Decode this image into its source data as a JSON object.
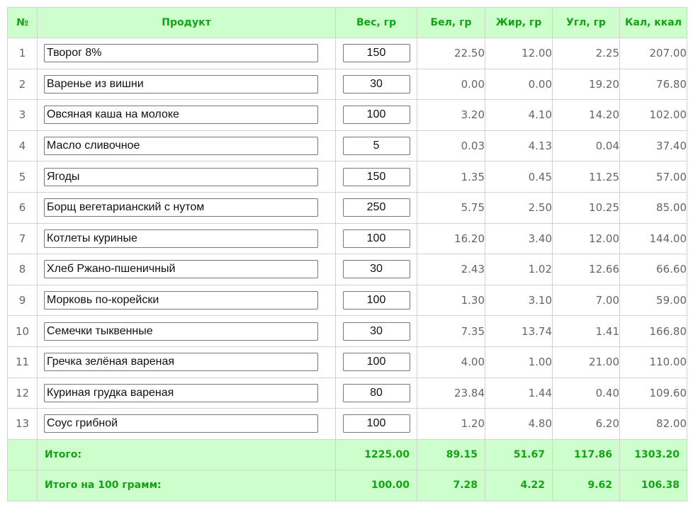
{
  "headers": {
    "num": "№",
    "product": "Продукт",
    "weight": "Вес, гр",
    "protein": "Бел, гр",
    "fat": "Жир, гр",
    "carbs": "Угл, гр",
    "kcal": "Кал, ккал"
  },
  "rows": [
    {
      "num": "1",
      "product": "Творог 8%",
      "weight": "150",
      "protein": "22.50",
      "fat": "12.00",
      "carbs": "2.25",
      "kcal": "207.00"
    },
    {
      "num": "2",
      "product": "Варенье из вишни",
      "weight": "30",
      "protein": "0.00",
      "fat": "0.00",
      "carbs": "19.20",
      "kcal": "76.80"
    },
    {
      "num": "3",
      "product": "Овсяная каша на молоке",
      "weight": "100",
      "protein": "3.20",
      "fat": "4.10",
      "carbs": "14.20",
      "kcal": "102.00"
    },
    {
      "num": "4",
      "product": "Масло сливочное",
      "weight": "5",
      "protein": "0.03",
      "fat": "4.13",
      "carbs": "0.04",
      "kcal": "37.40"
    },
    {
      "num": "5",
      "product": "Ягоды",
      "weight": "150",
      "protein": "1.35",
      "fat": "0.45",
      "carbs": "11.25",
      "kcal": "57.00"
    },
    {
      "num": "6",
      "product": "Борщ вегетарианский с нутом",
      "weight": "250",
      "protein": "5.75",
      "fat": "2.50",
      "carbs": "10.25",
      "kcal": "85.00"
    },
    {
      "num": "7",
      "product": "Котлеты куриные",
      "weight": "100",
      "protein": "16.20",
      "fat": "3.40",
      "carbs": "12.00",
      "kcal": "144.00"
    },
    {
      "num": "8",
      "product": "Хлеб Ржано-пшеничный",
      "weight": "30",
      "protein": "2.43",
      "fat": "1.02",
      "carbs": "12.66",
      "kcal": "66.60"
    },
    {
      "num": "9",
      "product": "Морковь по-корейски",
      "weight": "100",
      "protein": "1.30",
      "fat": "3.10",
      "carbs": "7.00",
      "kcal": "59.00"
    },
    {
      "num": "10",
      "product": "Семечки тыквенные",
      "weight": "30",
      "protein": "7.35",
      "fat": "13.74",
      "carbs": "1.41",
      "kcal": "166.80"
    },
    {
      "num": "11",
      "product": "Гречка зелёная вареная",
      "weight": "100",
      "protein": "4.00",
      "fat": "1.00",
      "carbs": "21.00",
      "kcal": "110.00"
    },
    {
      "num": "12",
      "product": "Куриная грудка вареная",
      "weight": "80",
      "protein": "23.84",
      "fat": "1.44",
      "carbs": "0.40",
      "kcal": "109.60"
    },
    {
      "num": "13",
      "product": "Соус грибной",
      "weight": "100",
      "protein": "1.20",
      "fat": "4.80",
      "carbs": "6.20",
      "kcal": "82.00"
    }
  ],
  "totals": {
    "label": "Итого:",
    "weight": "1225.00",
    "protein": "89.15",
    "fat": "51.67",
    "carbs": "117.86",
    "kcal": "1303.20"
  },
  "per100": {
    "label": "Итого на 100 грамм:",
    "weight": "100.00",
    "protein": "7.28",
    "fat": "4.22",
    "carbs": "9.62",
    "kcal": "106.38"
  },
  "colors": {
    "header_bg": "#ccffcc",
    "header_text": "#13a313",
    "border": "#d2d2d2",
    "body_text": "#666666"
  }
}
